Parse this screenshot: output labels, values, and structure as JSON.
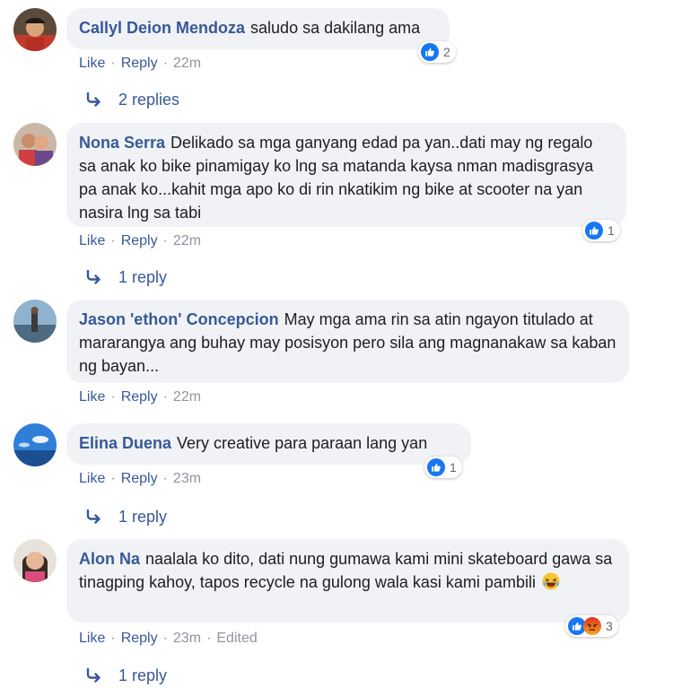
{
  "comments": [
    {
      "author": "Callyl Deion Mendoza",
      "text": "saludo sa dakilang ama",
      "actions": {
        "like": "Like",
        "reply": "Reply",
        "time": "22m"
      },
      "reactions": {
        "icons": [
          "like-icon"
        ],
        "count": "2"
      },
      "replies": "2 replies"
    },
    {
      "author": "Nona Serra",
      "text": "Delikado sa mga ganyang edad pa yan..dati may ng regalo sa anak ko bike pinamigay ko lng sa matanda kaysa nman madisgrasya pa anak ko...kahit mga apo ko di rin nkatikim ng bike at scooter na yan nasira lng sa tabi",
      "actions": {
        "like": "Like",
        "reply": "Reply",
        "time": "22m"
      },
      "reactions": {
        "icons": [
          "like-icon"
        ],
        "count": "1"
      },
      "replies": "1 reply"
    },
    {
      "author": "Jason 'ethon' Concepcion",
      "text": "May mga ama rin sa atin ngayon titulado at mararangya ang buhay may posisyon pero sila ang magnanakaw sa kaban ng bayan...",
      "actions": {
        "like": "Like",
        "reply": "Reply",
        "time": "22m"
      }
    },
    {
      "author": "Elina Duena",
      "text": "Very creative para paraan lang yan",
      "actions": {
        "like": "Like",
        "reply": "Reply",
        "time": "23m"
      },
      "reactions": {
        "icons": [
          "like-icon"
        ],
        "count": "1"
      },
      "replies": "1 reply"
    },
    {
      "author": "Alon Na",
      "text": "naalala ko dito, dati nung gumawa kami mini skateboard gawa sa tinagping kahoy, tapos recycle na gulong wala kasi kami pambili",
      "emoji": "laughing-emoji",
      "actions": {
        "like": "Like",
        "reply": "Reply",
        "time": "23m",
        "edited": "Edited"
      },
      "reactions": {
        "icons": [
          "like-icon",
          "angry-icon"
        ],
        "count": "3"
      },
      "replies": "1 reply"
    }
  ],
  "colors": {
    "link": "#385898",
    "bubble": "#f0f2f5",
    "muted": "#90949c",
    "like_blue": "#1877f2",
    "angry_orange": "#e9710f"
  }
}
